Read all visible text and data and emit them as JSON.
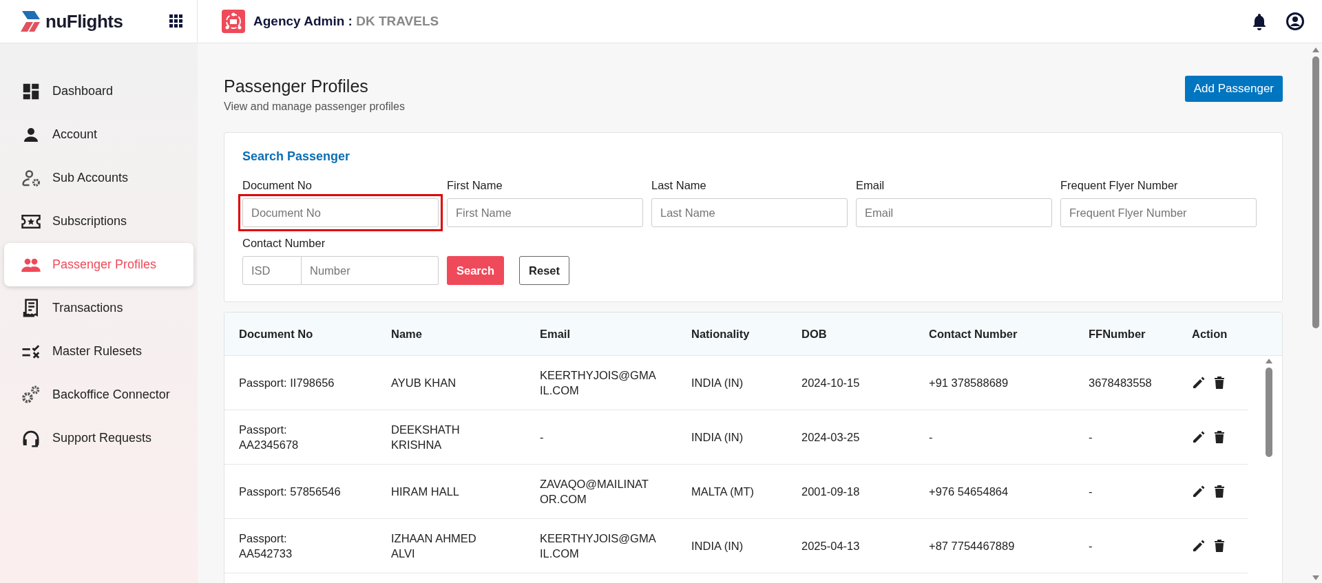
{
  "header": {
    "brand": "nuFlights",
    "role": "Agency Admin :",
    "agency": "DK TRAVELS"
  },
  "sidebar": {
    "items": [
      {
        "label": "Dashboard",
        "selected": false
      },
      {
        "label": "Account",
        "selected": false
      },
      {
        "label": "Sub Accounts",
        "selected": false
      },
      {
        "label": "Subscriptions",
        "selected": false
      },
      {
        "label": "Passenger Profiles",
        "selected": true
      },
      {
        "label": "Transactions",
        "selected": false
      },
      {
        "label": "Master Rulesets",
        "selected": false
      },
      {
        "label": "Backoffice Connector",
        "selected": false
      },
      {
        "label": "Support Requests",
        "selected": false
      }
    ]
  },
  "page": {
    "title": "Passenger Profiles",
    "subtitle": "View and manage passenger profiles",
    "add_button": "Add Passenger"
  },
  "search": {
    "title": "Search Passenger",
    "fields": [
      {
        "label": "Document No",
        "placeholder": "Document No",
        "highlighted": true
      },
      {
        "label": "First Name",
        "placeholder": "First Name",
        "highlighted": false
      },
      {
        "label": "Last Name",
        "placeholder": "Last Name",
        "highlighted": false
      },
      {
        "label": "Email",
        "placeholder": "Email",
        "highlighted": false
      },
      {
        "label": "Frequent Flyer Number",
        "placeholder": "Frequent Flyer Number",
        "highlighted": false
      }
    ],
    "contact": {
      "label": "Contact Number",
      "isd_placeholder": "ISD",
      "number_placeholder": "Number"
    },
    "search_button": "Search",
    "reset_button": "Reset"
  },
  "table": {
    "columns": [
      "Document No",
      "Name",
      "Email",
      "Nationality",
      "DOB",
      "Contact Number",
      "FFNumber",
      "Action"
    ],
    "rows": [
      [
        "Passport: II798656",
        "AYUB KHAN",
        "KEERTHYJOIS@GMAIL.COM",
        "INDIA (IN)",
        "2024-10-15",
        "+91 378588689",
        "3678483558"
      ],
      [
        "Passport: AA2345678",
        "DEEKSHATH KRISHNA",
        "-",
        "INDIA (IN)",
        "2024-03-25",
        "-",
        "-"
      ],
      [
        "Passport: 57856546",
        "HIRAM HALL",
        "ZAVAQO@MAILINATOR.COM",
        "MALTA (MT)",
        "2001-09-18",
        "+976 54654864",
        "-"
      ],
      [
        "Passport: AA542733",
        "IZHAAN AHMED ALVI",
        "KEERTHYJOIS@GMAIL.COM",
        "INDIA (IN)",
        "2025-04-13",
        "+87 7754467889",
        "-"
      ]
    ]
  }
}
